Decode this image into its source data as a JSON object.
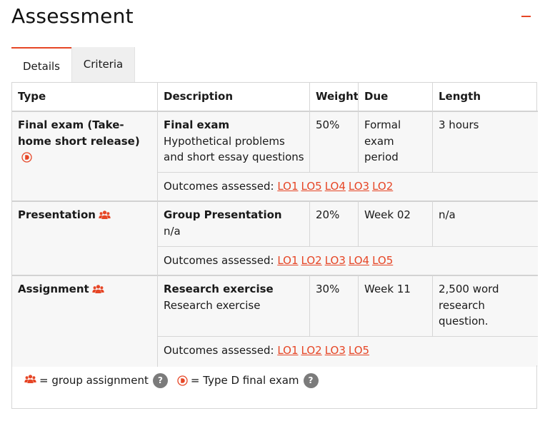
{
  "page": {
    "title": "Assessment",
    "accent_color": "#e64626",
    "collapse_icon": "minus-icon"
  },
  "tabs": [
    {
      "label": "Details",
      "active": true
    },
    {
      "label": "Criteria",
      "active": false
    }
  ],
  "table": {
    "headers": {
      "type": "Type",
      "description": "Description",
      "weight": "Weight",
      "due": "Due",
      "length": "Length"
    },
    "outcomes_prefix": "Outcomes assessed:",
    "rows": [
      {
        "type": "Final exam (Take-home short release)",
        "type_icon": "type-d-icon",
        "desc_title": "Final exam",
        "desc_text": "Hypothetical problems and short essay questions",
        "weight": "50%",
        "due": "Formal exam period",
        "length": "3 hours",
        "outcomes": [
          "LO1",
          "LO5",
          "LO4",
          "LO3",
          "LO2"
        ]
      },
      {
        "type": "Presentation",
        "type_icon": "group-icon",
        "desc_title": "Group Presentation",
        "desc_text": "n/a",
        "weight": "20%",
        "due": "Week 02",
        "length": "n/a",
        "outcomes": [
          "LO1",
          "LO2",
          "LO3",
          "LO4",
          "LO5"
        ]
      },
      {
        "type": "Assignment",
        "type_icon": "group-icon",
        "desc_title": "Research exercise",
        "desc_text": "Research exercise",
        "weight": "30%",
        "due": "Week 11",
        "length": "2,500 word research question.",
        "outcomes": [
          "LO1",
          "LO2",
          "LO3",
          "LO5"
        ]
      }
    ]
  },
  "legend": {
    "group_text": "= group assignment",
    "type_d_text": "= Type D final exam",
    "help_glyph": "?"
  }
}
